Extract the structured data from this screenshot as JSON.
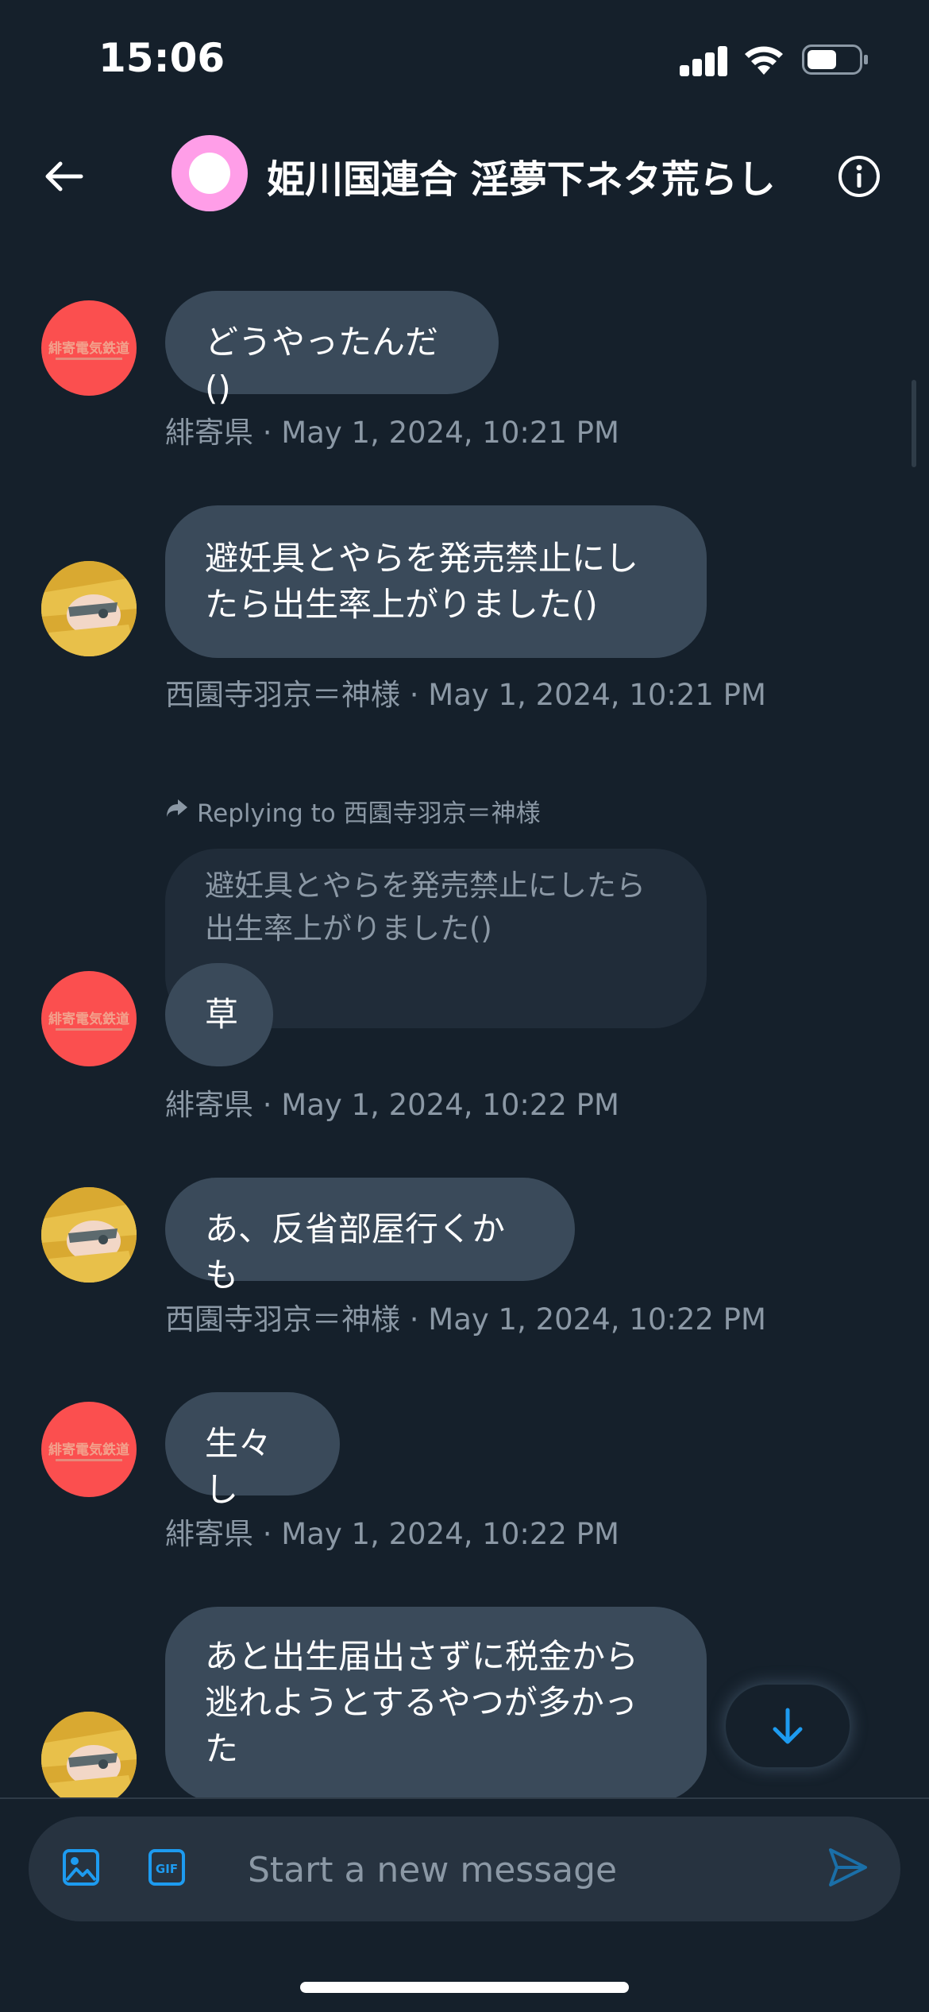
{
  "status_bar": {
    "time": "15:06"
  },
  "header": {
    "title": "姫川国連合 淫夢下ネタ荒らし"
  },
  "messages": [
    {
      "text": "どうやったんだ()",
      "meta": "緋寄県 · May 1, 2024, 10:21 PM"
    },
    {
      "text": "避妊具とやらを発売禁止にしたら出生率上がりました()",
      "meta": "西園寺羽京＝神様 · May 1, 2024, 10:21 PM"
    },
    {
      "reply_label": "Replying to 西園寺羽京＝神様",
      "quote": "避妊具とやらを発売禁止にしたら出生率上がりました()",
      "text": "草",
      "meta": "緋寄県 · May 1, 2024, 10:22 PM"
    },
    {
      "text": "あ、反省部屋行くかも",
      "meta": "西園寺羽京＝神様 · May 1, 2024, 10:22 PM"
    },
    {
      "text": "生々し",
      "meta": "緋寄県 · May 1, 2024, 10:22 PM"
    },
    {
      "text": "あと出生届出さずに税金から逃れようとするやつが多かった"
    }
  ],
  "avatar_text": {
    "line1": "緋寄電気鉄道"
  },
  "composer": {
    "placeholder": "Start a new message"
  },
  "colors": {
    "accent": "#1d9bf0",
    "background": "#15202b",
    "bubble": "#3a4a5a"
  }
}
